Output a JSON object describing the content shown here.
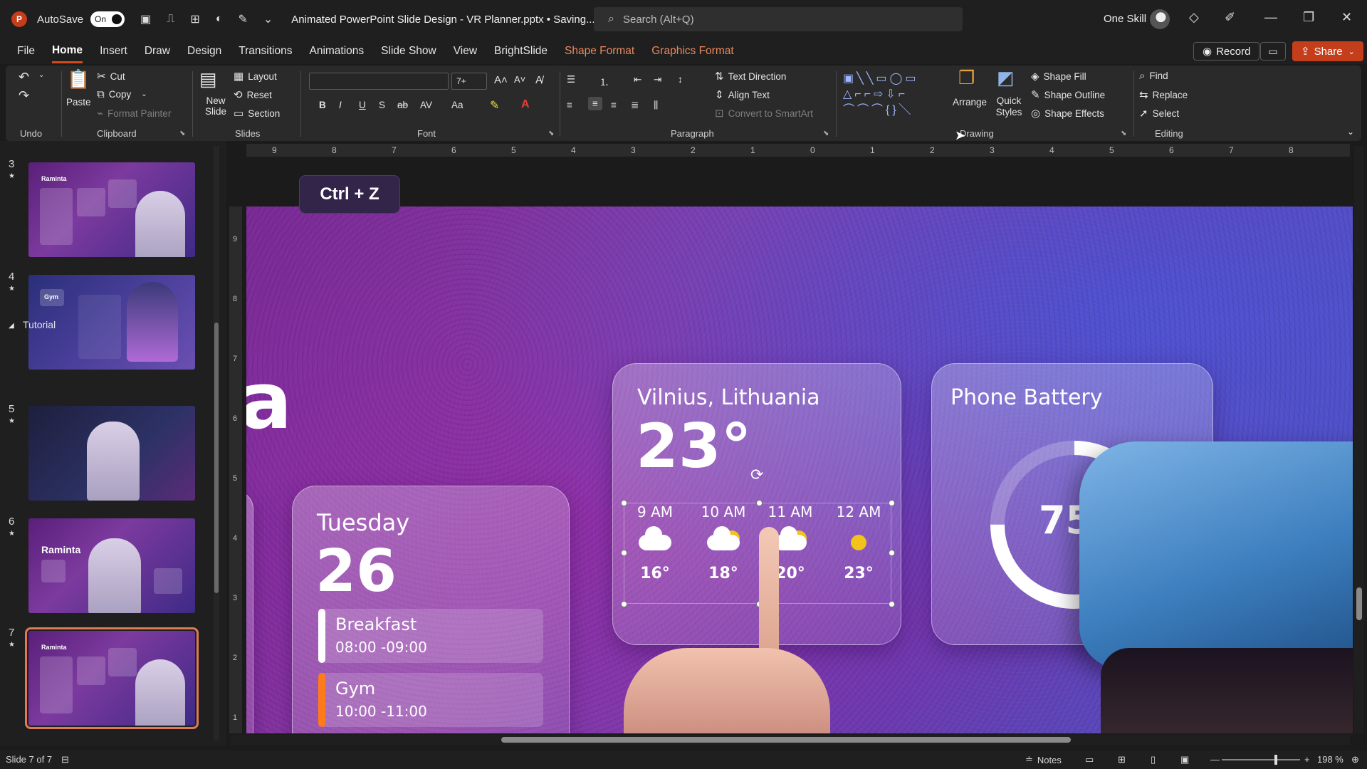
{
  "titlebar": {
    "autosave_label": "AutoSave",
    "autosave_state": "On",
    "doc_title": "Animated PowerPoint Slide Design - VR Planner.pptx • Saving...",
    "search_placeholder": "Search (Alt+Q)",
    "user_name": "One Skill"
  },
  "tabs": [
    "File",
    "Home",
    "Insert",
    "Draw",
    "Design",
    "Transitions",
    "Animations",
    "Slide Show",
    "View",
    "BrightSlide",
    "Shape Format",
    "Graphics Format"
  ],
  "active_tab": "Home",
  "actions": {
    "record": "Record",
    "share": "Share"
  },
  "ribbon": {
    "undo_group": "Undo",
    "clipboard": {
      "paste": "Paste",
      "cut": "Cut",
      "copy": "Copy",
      "format_painter": "Format Painter",
      "label": "Clipboard"
    },
    "slides": {
      "new_slide": "New Slide",
      "layout": "Layout",
      "reset": "Reset",
      "section": "Section",
      "label": "Slides"
    },
    "font": {
      "font_size": "7+",
      "label": "Font"
    },
    "paragraph": {
      "text_direction": "Text Direction",
      "align_text": "Align Text",
      "convert_smartart": "Convert to SmartArt",
      "label": "Paragraph"
    },
    "drawing": {
      "arrange": "Arrange",
      "quick_styles": "Quick Styles",
      "shape_fill": "Shape Fill",
      "shape_outline": "Shape Outline",
      "shape_effects": "Shape Effects",
      "label": "Drawing"
    },
    "editing": {
      "find": "Find",
      "replace": "Replace",
      "select": "Select",
      "label": "Editing"
    }
  },
  "thumbnails": {
    "section_name": "Tutorial",
    "items": [
      {
        "num": "3",
        "title": "Raminta"
      },
      {
        "num": "4",
        "title": "Gym"
      },
      {
        "num": "5",
        "title": ""
      },
      {
        "num": "6",
        "title": "Raminta"
      },
      {
        "num": "7",
        "title": "Raminta"
      }
    ],
    "selected": "7"
  },
  "hruler_labels": [
    "9",
    "8",
    "7",
    "6",
    "5",
    "4",
    "3",
    "2",
    "1",
    "0",
    "1",
    "2",
    "3",
    "4",
    "5",
    "6",
    "7",
    "8"
  ],
  "vruler_labels": [
    "9",
    "8",
    "7",
    "6",
    "5",
    "4",
    "3",
    "2",
    "1"
  ],
  "slide": {
    "shortcut_badge": "Ctrl + Z",
    "partial_letter": "a",
    "weather": {
      "city": "Vilnius, Lithuania",
      "temp": "23°",
      "hours": [
        {
          "time": "9 AM",
          "icon": "cloud-icon",
          "temp": "16°"
        },
        {
          "time": "10 AM",
          "icon": "partly-sunny-icon",
          "temp": "18°"
        },
        {
          "time": "11 AM",
          "icon": "partly-sunny-icon",
          "temp": "20°"
        },
        {
          "time": "12 AM",
          "icon": "sun-icon",
          "temp": "23°"
        }
      ]
    },
    "battery": {
      "title": "Phone Battery",
      "percent_text": "75%",
      "percent_value": 0.75
    },
    "day": {
      "weekday": "Tuesday",
      "date": "26",
      "events": [
        {
          "name": "Breakfast",
          "time": "08:00 -09:00",
          "color": "#ffffff"
        },
        {
          "name": "Gym",
          "time": "10:00 -11:00",
          "color": "#ff7a1a"
        }
      ]
    }
  },
  "status": {
    "slide_info": "Slide 7 of 7",
    "notes": "Notes",
    "zoom": "198 %"
  },
  "colors": {
    "accent": "#c43e1c",
    "tab_underline": "#d5491f",
    "context_tab": "#e8885f"
  }
}
